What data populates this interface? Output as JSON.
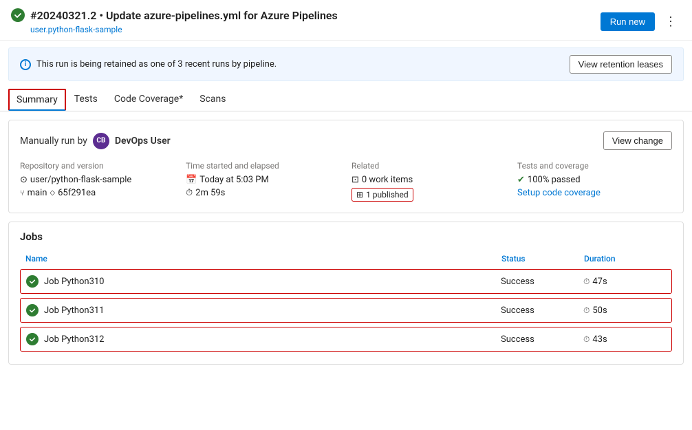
{
  "header": {
    "run_id": "#20240321.2",
    "title": "#20240321.2 • Update azure-pipelines.yml for Azure Pipelines",
    "subtitle_link": "user.python-flask-sample",
    "run_new_label": "Run new",
    "more_options_icon": "⋮"
  },
  "banner": {
    "text": "This run is being retained as one of 3 recent runs by pipeline.",
    "button_label": "View retention leases"
  },
  "tabs": [
    {
      "label": "Summary",
      "active": true
    },
    {
      "label": "Tests",
      "active": false
    },
    {
      "label": "Code Coverage*",
      "active": false
    },
    {
      "label": "Scans",
      "active": false
    }
  ],
  "summary": {
    "manually_run_label": "Manually run by",
    "user_initials": "CB",
    "user_name": "DevOps User",
    "view_change_label": "View change",
    "meta": {
      "repo_section_label": "Repository and version",
      "repo_name": "user/python-flask-sample",
      "branch": "main",
      "commit": "65f291ea",
      "time_section_label": "Time started and elapsed",
      "time_started": "Today at 5:03 PM",
      "elapsed": "2m 59s",
      "related_section_label": "Related",
      "work_items": "0 work items",
      "published_count": "1 published",
      "tests_section_label": "Tests and coverage",
      "tests_passed": "100% passed",
      "setup_coverage_label": "Setup code coverage"
    }
  },
  "jobs": {
    "section_title": "Jobs",
    "columns": {
      "name": "Name",
      "status": "Status",
      "duration": "Duration"
    },
    "rows": [
      {
        "name": "Job Python310",
        "status": "Success",
        "duration": "47s"
      },
      {
        "name": "Job Python311",
        "status": "Success",
        "duration": "50s"
      },
      {
        "name": "Job Python312",
        "status": "Success",
        "duration": "43s"
      }
    ]
  }
}
